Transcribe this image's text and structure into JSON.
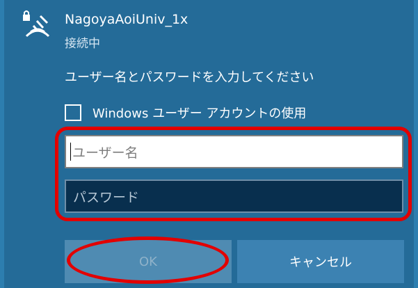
{
  "network": {
    "ssid": "NagoyaAoiUniv_1x",
    "status": "接続中",
    "icon": "wifi-secured-icon"
  },
  "prompt": "ユーザー名とパスワードを入力してください",
  "checkbox": {
    "label": "Windows ユーザー アカウントの使用",
    "checked": false
  },
  "username": {
    "placeholder": "ユーザー名",
    "value": ""
  },
  "password": {
    "placeholder": "パスワード",
    "value": ""
  },
  "buttons": {
    "ok_label": "OK",
    "cancel_label": "キャンセル"
  },
  "colors": {
    "panel_background": "#246b98",
    "highlight": "#e20000"
  }
}
